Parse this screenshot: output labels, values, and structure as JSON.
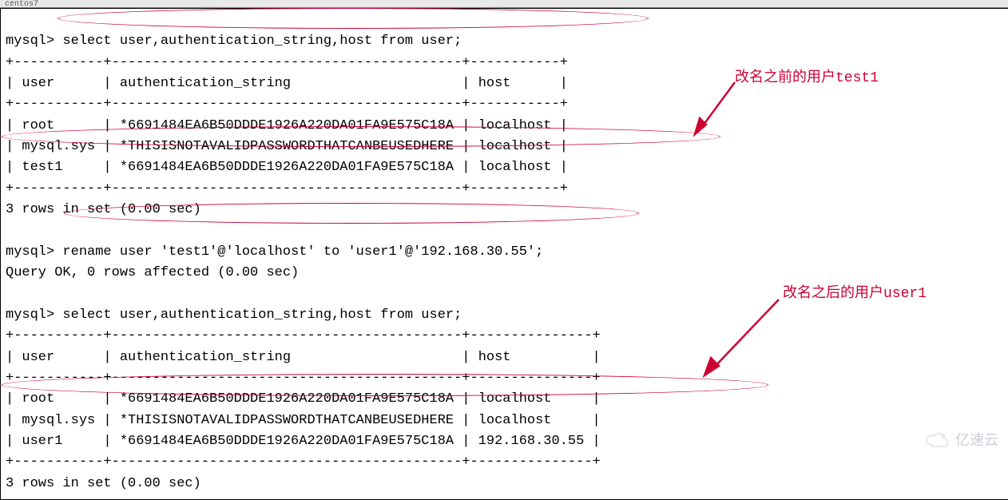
{
  "tab_label": "centos7",
  "prompt": "mysql>",
  "query1": "select user,authentication_string,host from user;",
  "table1": {
    "sep": "+-----------+-------------------------------------------+-----------+",
    "head": "| user      | authentication_string                     | host      |",
    "rows": [
      "| root      | *6691484EA6B50DDDE1926A220DA01FA9E575C18A | localhost |",
      "| mysql.sys | *THISISNOTAVALIDPASSWORDTHATCANBEUSEDHERE | localhost |",
      "| test1     | *6691484EA6B50DDDE1926A220DA01FA9E575C18A | localhost |"
    ],
    "footer": "3 rows in set (0.00 sec)"
  },
  "query2": "rename user 'test1'@'localhost' to 'user1'@'192.168.30.55';",
  "result2": "Query OK, 0 rows affected (0.00 sec)",
  "query3": "select user,authentication_string,host from user;",
  "table2": {
    "sep": "+-----------+-------------------------------------------+---------------+",
    "head": "| user      | authentication_string                     | host          |",
    "rows": [
      "| root      | *6691484EA6B50DDDE1926A220DA01FA9E575C18A | localhost     |",
      "| mysql.sys | *THISISNOTAVALIDPASSWORDTHATCANBEUSEDHERE | localhost     |",
      "| user1     | *6691484EA6B50DDDE1926A220DA01FA9E575C18A | 192.168.30.55 |"
    ],
    "footer": "3 rows in set (0.00 sec)"
  },
  "annotations": {
    "note1": "改名之前的用户test1",
    "note2": "改名之后的用户user1"
  },
  "watermark": "亿速云"
}
